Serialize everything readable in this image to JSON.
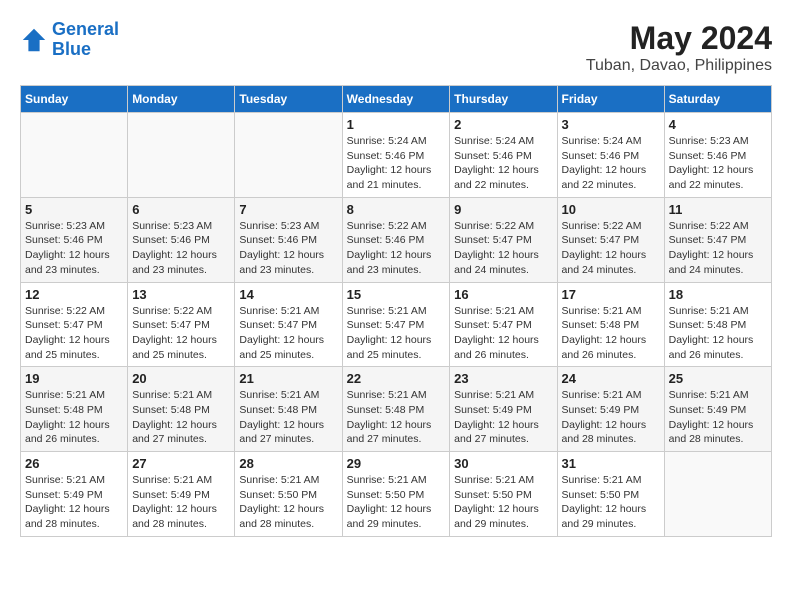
{
  "header": {
    "logo_line1": "General",
    "logo_line2": "Blue",
    "title": "May 2024",
    "subtitle": "Tuban, Davao, Philippines"
  },
  "weekdays": [
    "Sunday",
    "Monday",
    "Tuesday",
    "Wednesday",
    "Thursday",
    "Friday",
    "Saturday"
  ],
  "weeks": [
    [
      {
        "day": "",
        "info": ""
      },
      {
        "day": "",
        "info": ""
      },
      {
        "day": "",
        "info": ""
      },
      {
        "day": "1",
        "info": "Sunrise: 5:24 AM\nSunset: 5:46 PM\nDaylight: 12 hours\nand 21 minutes."
      },
      {
        "day": "2",
        "info": "Sunrise: 5:24 AM\nSunset: 5:46 PM\nDaylight: 12 hours\nand 22 minutes."
      },
      {
        "day": "3",
        "info": "Sunrise: 5:24 AM\nSunset: 5:46 PM\nDaylight: 12 hours\nand 22 minutes."
      },
      {
        "day": "4",
        "info": "Sunrise: 5:23 AM\nSunset: 5:46 PM\nDaylight: 12 hours\nand 22 minutes."
      }
    ],
    [
      {
        "day": "5",
        "info": "Sunrise: 5:23 AM\nSunset: 5:46 PM\nDaylight: 12 hours\nand 23 minutes."
      },
      {
        "day": "6",
        "info": "Sunrise: 5:23 AM\nSunset: 5:46 PM\nDaylight: 12 hours\nand 23 minutes."
      },
      {
        "day": "7",
        "info": "Sunrise: 5:23 AM\nSunset: 5:46 PM\nDaylight: 12 hours\nand 23 minutes."
      },
      {
        "day": "8",
        "info": "Sunrise: 5:22 AM\nSunset: 5:46 PM\nDaylight: 12 hours\nand 23 minutes."
      },
      {
        "day": "9",
        "info": "Sunrise: 5:22 AM\nSunset: 5:47 PM\nDaylight: 12 hours\nand 24 minutes."
      },
      {
        "day": "10",
        "info": "Sunrise: 5:22 AM\nSunset: 5:47 PM\nDaylight: 12 hours\nand 24 minutes."
      },
      {
        "day": "11",
        "info": "Sunrise: 5:22 AM\nSunset: 5:47 PM\nDaylight: 12 hours\nand 24 minutes."
      }
    ],
    [
      {
        "day": "12",
        "info": "Sunrise: 5:22 AM\nSunset: 5:47 PM\nDaylight: 12 hours\nand 25 minutes."
      },
      {
        "day": "13",
        "info": "Sunrise: 5:22 AM\nSunset: 5:47 PM\nDaylight: 12 hours\nand 25 minutes."
      },
      {
        "day": "14",
        "info": "Sunrise: 5:21 AM\nSunset: 5:47 PM\nDaylight: 12 hours\nand 25 minutes."
      },
      {
        "day": "15",
        "info": "Sunrise: 5:21 AM\nSunset: 5:47 PM\nDaylight: 12 hours\nand 25 minutes."
      },
      {
        "day": "16",
        "info": "Sunrise: 5:21 AM\nSunset: 5:47 PM\nDaylight: 12 hours\nand 26 minutes."
      },
      {
        "day": "17",
        "info": "Sunrise: 5:21 AM\nSunset: 5:48 PM\nDaylight: 12 hours\nand 26 minutes."
      },
      {
        "day": "18",
        "info": "Sunrise: 5:21 AM\nSunset: 5:48 PM\nDaylight: 12 hours\nand 26 minutes."
      }
    ],
    [
      {
        "day": "19",
        "info": "Sunrise: 5:21 AM\nSunset: 5:48 PM\nDaylight: 12 hours\nand 26 minutes."
      },
      {
        "day": "20",
        "info": "Sunrise: 5:21 AM\nSunset: 5:48 PM\nDaylight: 12 hours\nand 27 minutes."
      },
      {
        "day": "21",
        "info": "Sunrise: 5:21 AM\nSunset: 5:48 PM\nDaylight: 12 hours\nand 27 minutes."
      },
      {
        "day": "22",
        "info": "Sunrise: 5:21 AM\nSunset: 5:48 PM\nDaylight: 12 hours\nand 27 minutes."
      },
      {
        "day": "23",
        "info": "Sunrise: 5:21 AM\nSunset: 5:49 PM\nDaylight: 12 hours\nand 27 minutes."
      },
      {
        "day": "24",
        "info": "Sunrise: 5:21 AM\nSunset: 5:49 PM\nDaylight: 12 hours\nand 28 minutes."
      },
      {
        "day": "25",
        "info": "Sunrise: 5:21 AM\nSunset: 5:49 PM\nDaylight: 12 hours\nand 28 minutes."
      }
    ],
    [
      {
        "day": "26",
        "info": "Sunrise: 5:21 AM\nSunset: 5:49 PM\nDaylight: 12 hours\nand 28 minutes."
      },
      {
        "day": "27",
        "info": "Sunrise: 5:21 AM\nSunset: 5:49 PM\nDaylight: 12 hours\nand 28 minutes."
      },
      {
        "day": "28",
        "info": "Sunrise: 5:21 AM\nSunset: 5:50 PM\nDaylight: 12 hours\nand 28 minutes."
      },
      {
        "day": "29",
        "info": "Sunrise: 5:21 AM\nSunset: 5:50 PM\nDaylight: 12 hours\nand 29 minutes."
      },
      {
        "day": "30",
        "info": "Sunrise: 5:21 AM\nSunset: 5:50 PM\nDaylight: 12 hours\nand 29 minutes."
      },
      {
        "day": "31",
        "info": "Sunrise: 5:21 AM\nSunset: 5:50 PM\nDaylight: 12 hours\nand 29 minutes."
      },
      {
        "day": "",
        "info": ""
      }
    ]
  ]
}
